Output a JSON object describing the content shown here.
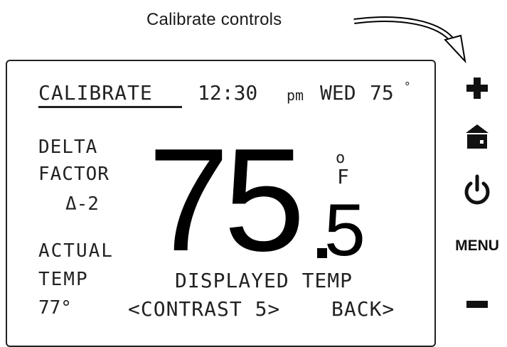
{
  "callout": {
    "text": "Calibrate controls"
  },
  "screen": {
    "mode": "CALIBRATE",
    "time": "12:30",
    "ampm": "pm",
    "day": "WED",
    "outdoor_temp": "75",
    "degree_symbol": "°",
    "delta_line1": "DELTA",
    "delta_line2": "FACTOR",
    "delta_value": "Δ-2",
    "actual_line1": "ACTUAL",
    "actual_line2": "TEMP",
    "actual_value": "77°",
    "displayed_temp_whole": "75",
    "displayed_temp_decimal": "5",
    "unit_degree": "o",
    "unit_letter": "F",
    "displayed_label": "DISPLAYED TEMP",
    "contrast_label": "<CONTRAST 5>",
    "back_label": "BACK>"
  },
  "side_buttons": {
    "plus_icon": "plus-icon",
    "home_icon": "home-icon",
    "power_icon": "power-icon",
    "menu_label": "MENU",
    "minus_icon": "minus-icon"
  }
}
